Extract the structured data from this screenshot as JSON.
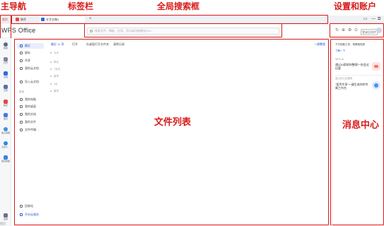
{
  "annotations": {
    "main_nav": "主导航",
    "tab_bar": "标签栏",
    "global_search": "全局搜索框",
    "settings_account": "设置和账户",
    "file_list": "文件列表",
    "message_center": "消息中心"
  },
  "tabs": [
    {
      "label": "首页"
    },
    {
      "label": "稿壳"
    },
    {
      "label": "文字文稿1"
    }
  ],
  "tab_add": "+",
  "app": {
    "logo": "WPS Office",
    "search_placeholder": "搜索文件、模板、应用、资讯或功能模块(Ctrl…"
  },
  "header_icons": [
    "↻",
    "⊕",
    "⚙",
    "⊙"
  ],
  "header_account_label": "登录后同步",
  "window_controls": [
    "▭",
    "—",
    "⧉"
  ],
  "nav_items": [
    {
      "label": "新建",
      "color": "#5c6b80"
    },
    {
      "label": "打开",
      "color": "#7b8596"
    },
    {
      "label": "文档",
      "color": "#2f6ae0"
    },
    {
      "label": "日历",
      "color": "#5a6fa6"
    },
    {
      "label": "稿壳",
      "color": "#e0483f"
    },
    {
      "label": "会议",
      "color": "#3b7be8"
    },
    {
      "label": "金山海报",
      "color": "#3e91e8"
    },
    {
      "label": "云办公…",
      "color": "#2c8be8"
    },
    {
      "label": "稻壳模板",
      "color": "#3c82d8"
    },
    {
      "label": "应用",
      "color": "#6b7384"
    }
  ],
  "left_panel": {
    "items": [
      {
        "label": "最近",
        "active": true
      },
      {
        "label": "星标",
        "active": false
      },
      {
        "label": "共享",
        "active": false
      },
      {
        "label": "我的云文档",
        "active": false
      },
      {
        "label": "导入云文档",
        "active": false
      }
    ],
    "section_label": "常用",
    "items2": [
      {
        "label": "我的电脑"
      },
      {
        "label": "我的桌面"
      },
      {
        "label": "我的文档"
      },
      {
        "label": "我的文件"
      },
      {
        "label": "文件传输…"
      }
    ],
    "bottom_items": [
      {
        "label": "回收站"
      },
      {
        "label": "开启云服务"
      }
    ]
  },
  "toolbar": {
    "items": [
      {
        "label": "最近 11 项",
        "active": true
      },
      {
        "label": "打开",
        "active": false
      },
      {
        "label": "在桌面打开文件夹",
        "active": false
      },
      {
        "label": "清除记录",
        "active": false
      }
    ],
    "right_link": "一键整理"
  },
  "file_rows": [
    "今天",
    "昨天",
    "7天内",
    "更早",
    "1月",
    "更早"
  ],
  "file_list_label": "文件列表",
  "message_panel": {
    "header": "下方的新工作，将帮我完成",
    "subheader": "了解一下",
    "cards": [
      {
        "tag": "WPS AI",
        "text": "通过AI帮助你整理一份会议纪要",
        "color": "#f27a6a"
      },
      {
        "tag": "金山办公云服务",
        "text": "“稻壳专享”一键生成你的专属工作台",
        "color": "#4f8df0"
      }
    ],
    "label": "消息中心"
  },
  "bottom_tag": "首页"
}
